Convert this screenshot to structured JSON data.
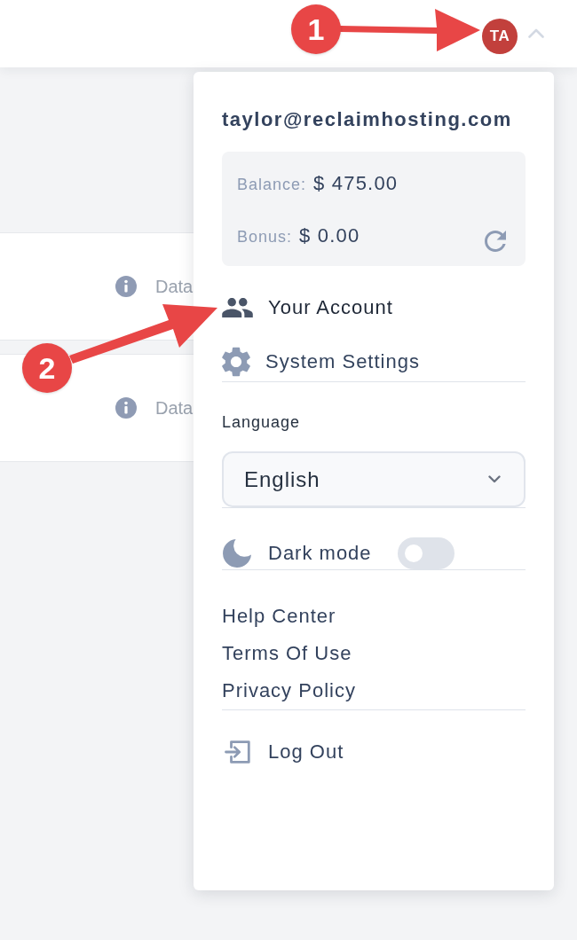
{
  "top_bar": {
    "avatar_initials": "TA",
    "menu_expanded": true
  },
  "content_cards": [
    {
      "label": "Data"
    },
    {
      "label": "Data"
    }
  ],
  "account_menu": {
    "email": "taylor@reclaimhosting.com",
    "wallet": [
      {
        "label": "Balance:",
        "value": "$ 475.00"
      },
      {
        "label": "Bonus:",
        "value": "$ 0.00"
      }
    ],
    "items": [
      {
        "kind": "account",
        "label": "Your Account",
        "hovered": true
      },
      {
        "kind": "settings",
        "label": "System Settings",
        "hovered": false
      }
    ],
    "language": {
      "label": "Language",
      "value": "English"
    },
    "dark_mode": {
      "label": "Dark mode",
      "on": false
    },
    "links": [
      "Help Center",
      "Terms Of Use",
      "Privacy Policy"
    ],
    "logout": {
      "label": "Log Out"
    }
  },
  "annotations": [
    {
      "number": "1"
    },
    {
      "number": "2"
    }
  ]
}
